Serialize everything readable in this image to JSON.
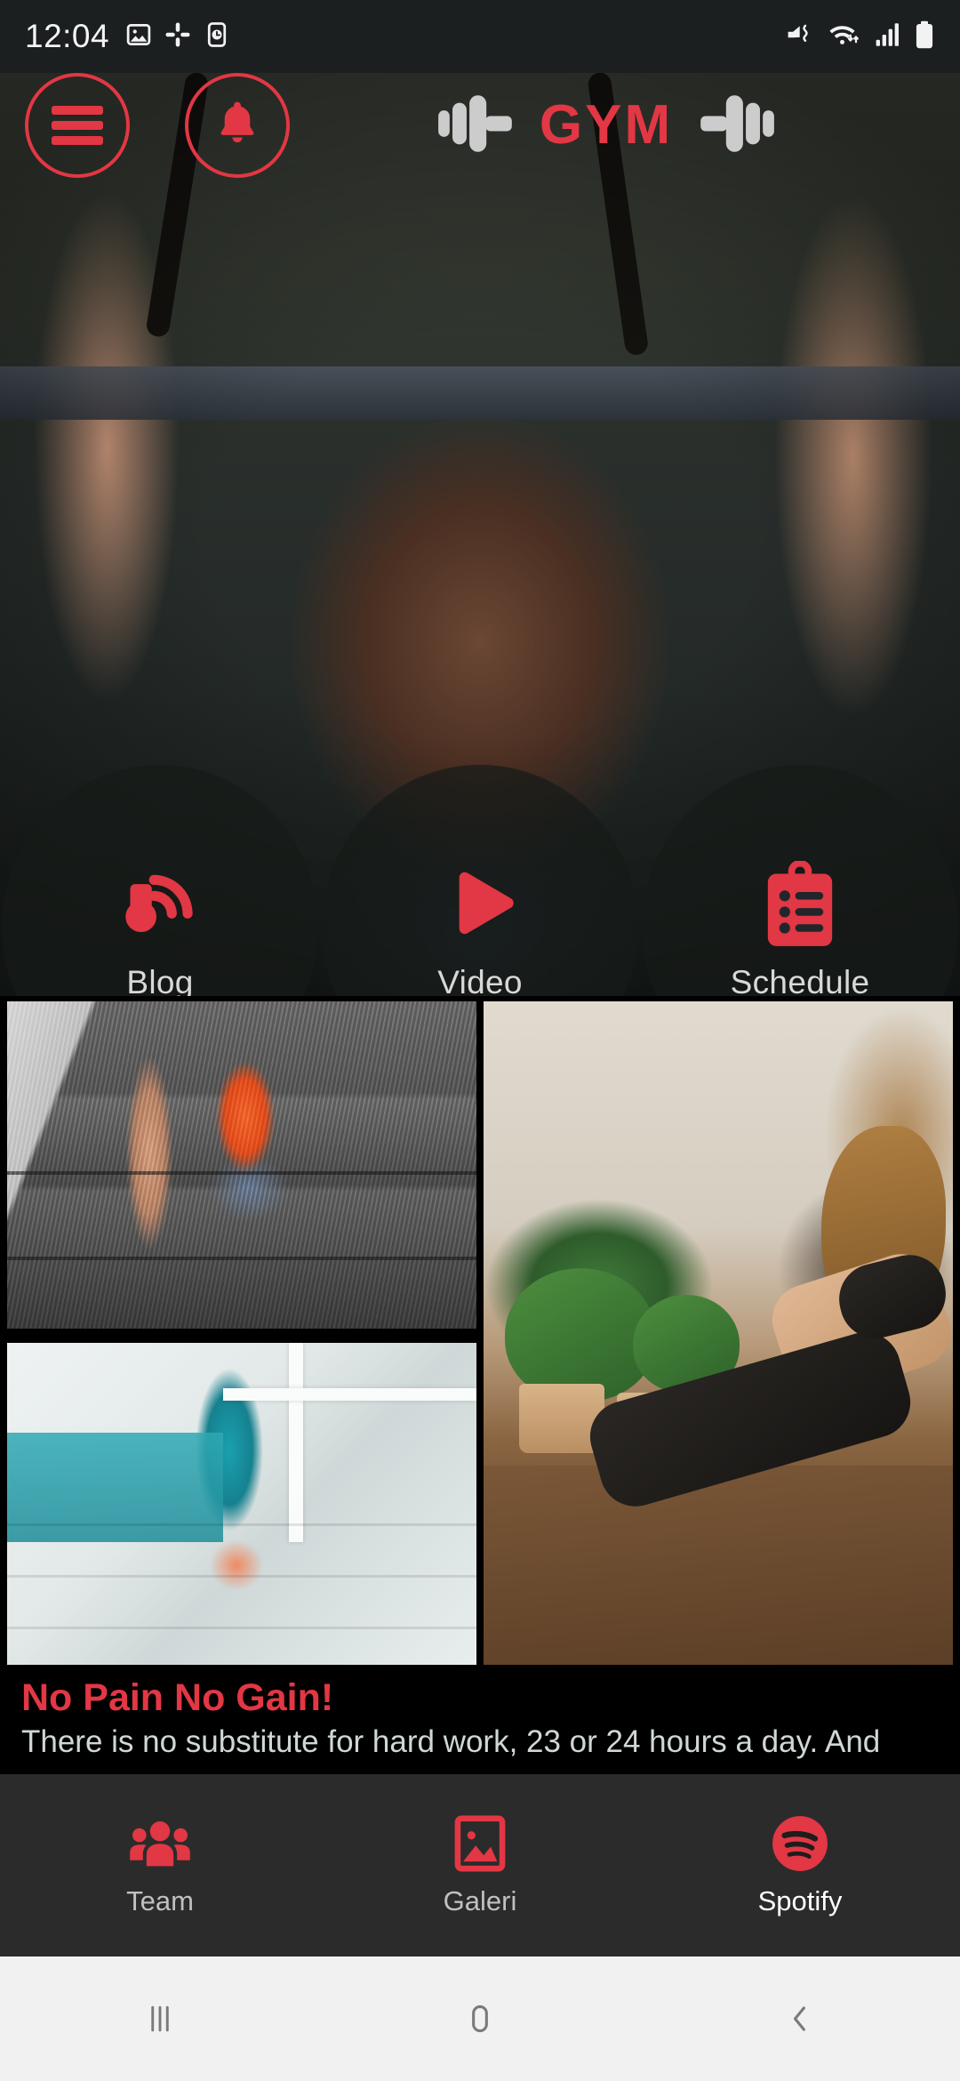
{
  "status_bar": {
    "time": "12:04",
    "left_icons": [
      "image-icon",
      "slack-icon",
      "clock-icon"
    ],
    "right_icons": [
      "mute-vibrate-icon",
      "wifi-icon",
      "signal-bars-icon",
      "battery-icon"
    ]
  },
  "header": {
    "menu_icon": "hamburger-menu-icon",
    "notification_icon": "bell-icon",
    "logo_text": "GYM",
    "logo_left_icon": "dumbbell-icon",
    "logo_right_icon": "dumbbell-icon"
  },
  "hero": {
    "alt": "woman performing pull-ups on gym bar"
  },
  "quick_actions": [
    {
      "label": "Blog",
      "icon": "blog-rss-icon"
    },
    {
      "label": "Video",
      "icon": "play-icon"
    },
    {
      "label": "Schedule",
      "icon": "clipboard-list-icon"
    }
  ],
  "gallery": [
    {
      "name": "running-shoes-on-steps",
      "alt": "legs in orange running shoes climbing concrete steps"
    },
    {
      "name": "teal-leggings-stairs",
      "alt": "legs in teal leggings walking up white stairs"
    },
    {
      "name": "yoga-plank-with-plants",
      "alt": "woman in side plank yoga pose beside potted plants"
    }
  ],
  "quote": {
    "title": "No Pain No Gain!",
    "body": "There is no substitute for hard work, 23 or 24 hours a day. And"
  },
  "bottom_nav": [
    {
      "label": "Team",
      "icon": "group-people-icon",
      "active": false
    },
    {
      "label": "Galeri",
      "icon": "image-gallery-icon",
      "active": false
    },
    {
      "label": "Spotify",
      "icon": "spotify-icon",
      "active": true
    }
  ],
  "system_nav": [
    {
      "name": "recents-button",
      "icon": "recents-icon"
    },
    {
      "name": "home-button",
      "icon": "home-circle-icon"
    },
    {
      "name": "back-button",
      "icon": "back-chevron-icon"
    }
  ],
  "colors": {
    "accent_red": "#e23744",
    "status_bar_bg": "#1b1f20",
    "bottom_nav_bg": "#2b2b2b",
    "system_nav_bg": "#f1f1f1",
    "quote_bg": "#000000"
  }
}
